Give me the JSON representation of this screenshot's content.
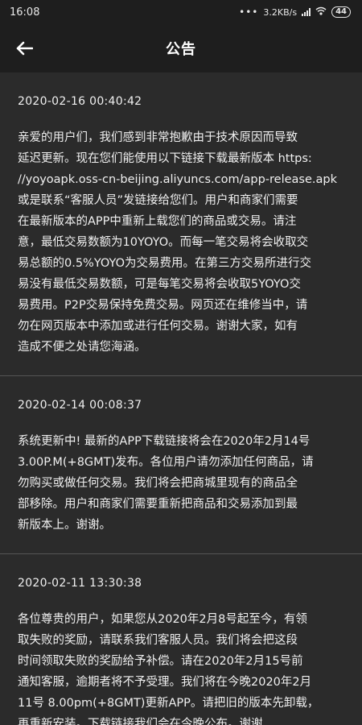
{
  "status_bar": {
    "time": "16:08",
    "dots": "•••",
    "speed": "3.2KB/s",
    "battery": "44"
  },
  "header": {
    "title": "公告",
    "back_icon": "arrow-left-icon"
  },
  "notices": [
    {
      "date": "2020-02-16 00:40:42",
      "lines": [
        "亲爱的用户们，我们感到非常抱歉由于技术原因而导致",
        "延迟更新。现在您们能使用以下链接下载最新版本 https:",
        "//yoyoapk.oss-cn-beijing.aliyuncs.com/app-release.apk",
        "或是联系“客服人员”发链接给您们。用户和商家们需要",
        "在最新版本的APP中重新上载您们的商品或交易。请注",
        "意，最低交易数额为10YOYO。而每一笔交易将会收取交",
        "易总额的0.5%YOYO为交易费用。在第三方交易所进行交",
        "易没有最低交易数额，可是每笔交易将会收取5YOYO交",
        "易费用。P2P交易保持免费交易。网页还在维修当中，请",
        "勿在网页版本中添加或进行任何交易。谢谢大家，如有",
        "造成不便之处请您海涵。"
      ]
    },
    {
      "date": "2020-02-14 00:08:37",
      "lines": [
        "系统更新中! 最新的APP下载链接将会在2020年2月14号",
        "3.00P.M(+8GMT)发布。各位用户请勿添加任何商品，请",
        "勿购买或做任何交易。我们将会把商城里现有的商品全",
        "部移除。用户和商家们需要重新把商品和交易添加到最",
        "新版本上。谢谢。"
      ]
    },
    {
      "date": "2020-02-11 13:30:38",
      "lines": [
        "各位尊贵的用户，如果您从2020年2月8号起至今，有领",
        "取失败的奖励，请联系我们客服人员。我们将会把这段",
        "时间领取失败的奖励给予补偿。请在2020年2月15号前",
        "通知客服，逾期者将不予受理。我们将在今晚2020年2月",
        "11号 8.00pm(+8GMT)更新APP。请把旧的版本先卸载，",
        "再重新安装。下载链接我们会在今晚公布。谢谢"
      ]
    }
  ]
}
